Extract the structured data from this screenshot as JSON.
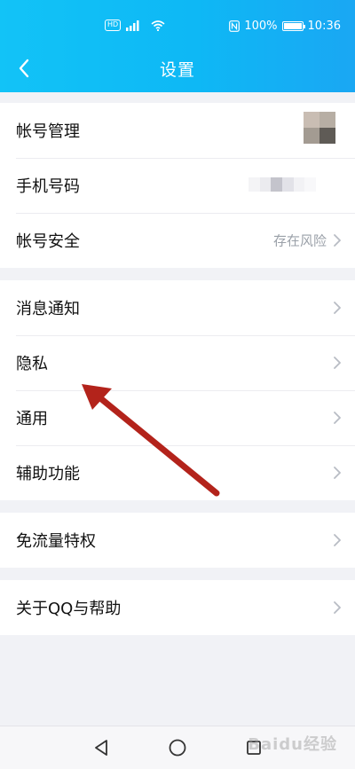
{
  "status_bar": {
    "hd_badge": "HD",
    "signal": "⁴⁶",
    "nfc": "N",
    "battery_percent": "100%",
    "battery_level": 1.0,
    "time": "10:36"
  },
  "header": {
    "title": "设置",
    "back_icon": "back-chevron-icon",
    "gradient_start": "#12c3f7",
    "gradient_end": "#1aa7f3"
  },
  "groups": [
    {
      "items": [
        {
          "label": "帐号管理",
          "value": "",
          "kind": "avatar"
        },
        {
          "label": "手机号码",
          "value": "",
          "kind": "phone"
        },
        {
          "label": "帐号安全",
          "value": "存在风险",
          "kind": "chevron"
        }
      ]
    },
    {
      "items": [
        {
          "label": "消息通知"
        },
        {
          "label": "隐私"
        },
        {
          "label": "通用"
        },
        {
          "label": "辅助功能"
        }
      ]
    },
    {
      "items": [
        {
          "label": "免流量特权"
        }
      ]
    },
    {
      "items": [
        {
          "label": "关于QQ与帮助"
        }
      ]
    }
  ],
  "bottom_nav": {
    "back": "triangle-back-icon",
    "home": "circle-home-icon",
    "recent": "square-recents-icon",
    "watermark": "Baidu经验"
  },
  "colors": {
    "header_bg": "#12c3f7",
    "page_bg": "#f1f2f6",
    "annotation_arrow": "#b3231b",
    "chevron": "#b8bcc4"
  }
}
